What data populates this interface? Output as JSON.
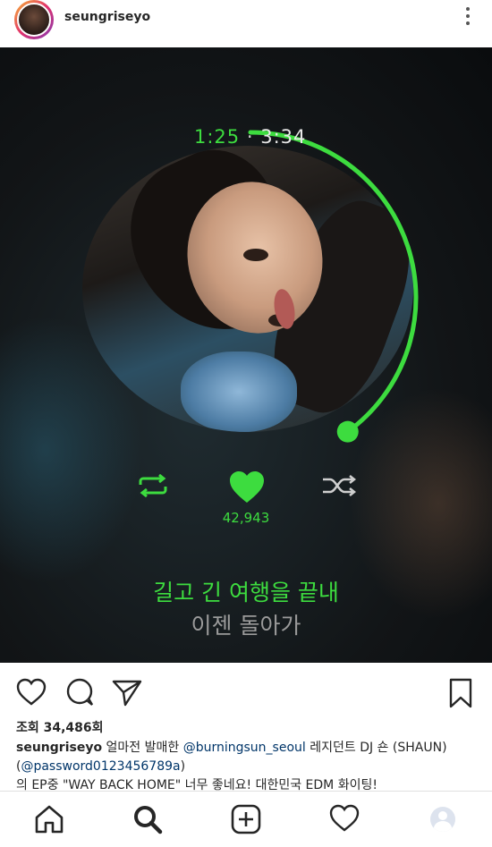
{
  "post": {
    "username": "seungriseyo"
  },
  "player": {
    "current_time": "1:25",
    "separator": "·",
    "total_time": "3:34",
    "progress": 0.4,
    "likes": "42,943",
    "lyric_line1": "길고 긴 여행을 끝내",
    "lyric_line2": "이젠 돌아가",
    "accent_color": "#3ddc3f"
  },
  "stats": {
    "views": "조회 34,486회"
  },
  "caption": {
    "username": "seungriseyo",
    "text1": " 얼마전 발매한 ",
    "mention1": "@burningsun_seoul",
    "text2": " 레지던트 DJ 숀 (SHAUN)",
    "paren_open": "(",
    "mention2": "@password0123456789a",
    "paren_close": ")",
    "line3": "의 EP중 \"WAY BACK HOME\" 너무 좋네요! 대한민국 EDM 화이팅!"
  },
  "icons": {
    "header_more": "more-vertical-icon",
    "like": "heart-outline-icon",
    "comment": "comment-icon",
    "share": "send-icon",
    "save": "bookmark-icon",
    "home": "home-icon",
    "search": "search-icon",
    "add": "add-post-icon",
    "activity": "heart-outline-icon",
    "profile": "profile-avatar"
  }
}
